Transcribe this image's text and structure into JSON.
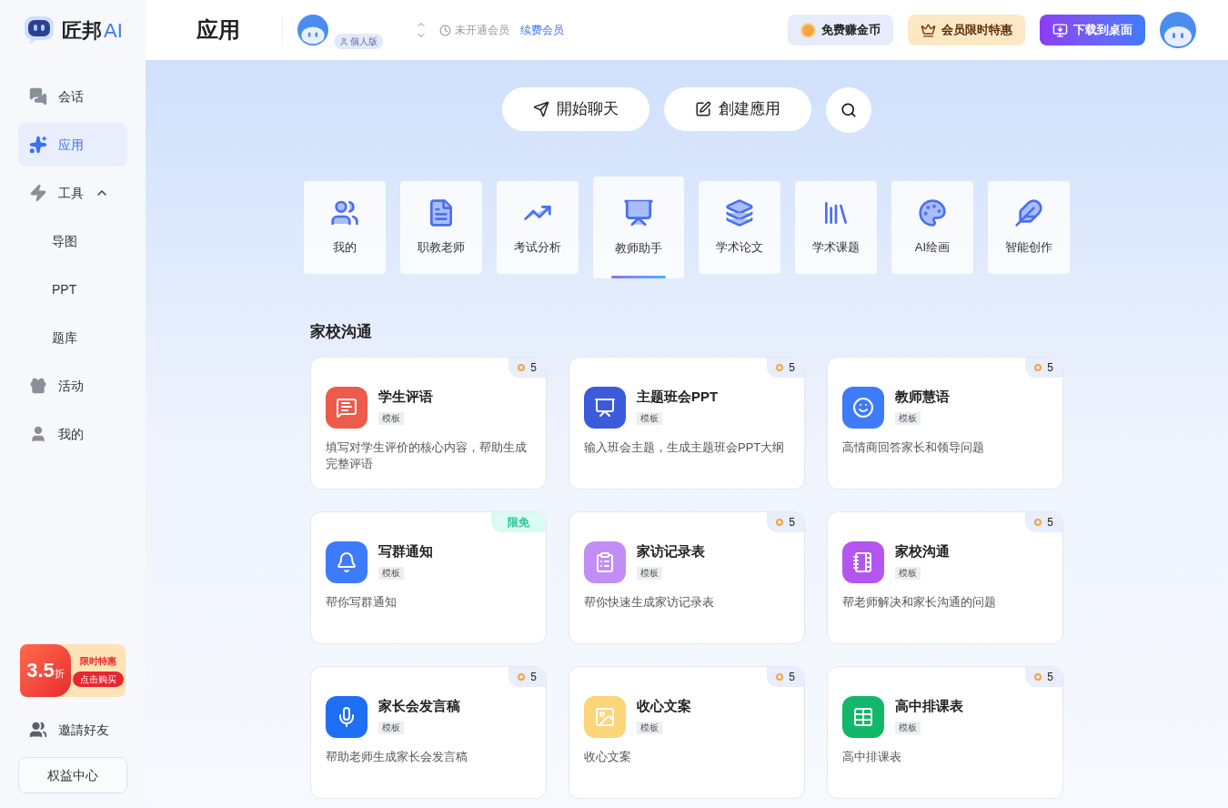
{
  "brand": {
    "name": "匠邦",
    "suffix": "AI"
  },
  "sidebar": {
    "items": [
      {
        "label": "会话",
        "selected": false
      },
      {
        "label": "应用",
        "selected": true
      },
      {
        "label": "工具",
        "selected": false,
        "expanded": true,
        "children": [
          {
            "label": "导图",
            "selected": false
          },
          {
            "label": "PPT",
            "selected": false
          },
          {
            "label": "题库",
            "selected": false
          }
        ]
      },
      {
        "label": "活动",
        "selected": false
      },
      {
        "label": "我的",
        "selected": false
      }
    ],
    "promo": {
      "discount": "3.5",
      "unit": "折",
      "title": "限时特惠",
      "action": "点击购买"
    },
    "invite": "邀請好友",
    "benefits": "权益中心"
  },
  "header": {
    "title": "应用",
    "plan": "個人版",
    "membership": "未开通会员",
    "renew": "续费会员",
    "buttons": [
      {
        "kind": "coins",
        "label": "免费赚金币"
      },
      {
        "kind": "vip",
        "label": "会员限时特惠"
      },
      {
        "kind": "download",
        "label": "下载到桌面"
      }
    ]
  },
  "actions": [
    {
      "label": "開始聊天"
    },
    {
      "label": "創建應用"
    }
  ],
  "categories": [
    {
      "label": "我的",
      "selected": false
    },
    {
      "label": "职教老师",
      "selected": false
    },
    {
      "label": "考试分析",
      "selected": false
    },
    {
      "label": "教师助手",
      "selected": true
    },
    {
      "label": "学术论文",
      "selected": false
    },
    {
      "label": "学术课题",
      "selected": false
    },
    {
      "label": "AI绘画",
      "selected": false
    },
    {
      "label": "智能创作",
      "selected": false
    }
  ],
  "section": {
    "title": "家校沟通",
    "cards": [
      {
        "title": "学生评语",
        "tag": "模板",
        "desc": "填写对学生评价的核心内容，帮助生成完整评语",
        "color": "#ec5b4b",
        "badge": {
          "kind": "coins",
          "text": "5"
        }
      },
      {
        "title": "主题班会PPT",
        "tag": "模板",
        "desc": "输入班会主题，生成主题班会PPT大纲",
        "color": "#3b5bdb",
        "badge": {
          "kind": "coins",
          "text": "5"
        }
      },
      {
        "title": "教师慧语",
        "tag": "模板",
        "desc": "高情商回答家长和领导问题",
        "color": "#3d7bfa",
        "badge": {
          "kind": "coins",
          "text": "5"
        }
      },
      {
        "title": "写群通知",
        "tag": "模板",
        "desc": "帮你写群通知",
        "color": "#3d7bfa",
        "badge": {
          "kind": "free",
          "text": "限免"
        }
      },
      {
        "title": "家访记录表",
        "tag": "模板",
        "desc": "帮你快速生成家访记录表",
        "color": "#c28ef5",
        "badge": {
          "kind": "coins",
          "text": "5"
        }
      },
      {
        "title": "家校沟通",
        "tag": "模板",
        "desc": "帮老师解决和家长沟通的问题",
        "color": "#b455f0",
        "badge": {
          "kind": "coins",
          "text": "5"
        }
      },
      {
        "title": "家长会发言稿",
        "tag": "模板",
        "desc": "帮助老师生成家长会发言稿",
        "color": "#1f6ff5",
        "badge": {
          "kind": "coins",
          "text": "5"
        }
      },
      {
        "title": "收心文案",
        "tag": "模板",
        "desc": "收心文案",
        "color": "#fcd47a",
        "badge": {
          "kind": "coins",
          "text": "5"
        }
      },
      {
        "title": "高中排课表",
        "tag": "模板",
        "desc": "高中排课表",
        "color": "#12b76a",
        "badge": {
          "kind": "coins",
          "text": "5"
        }
      }
    ]
  }
}
